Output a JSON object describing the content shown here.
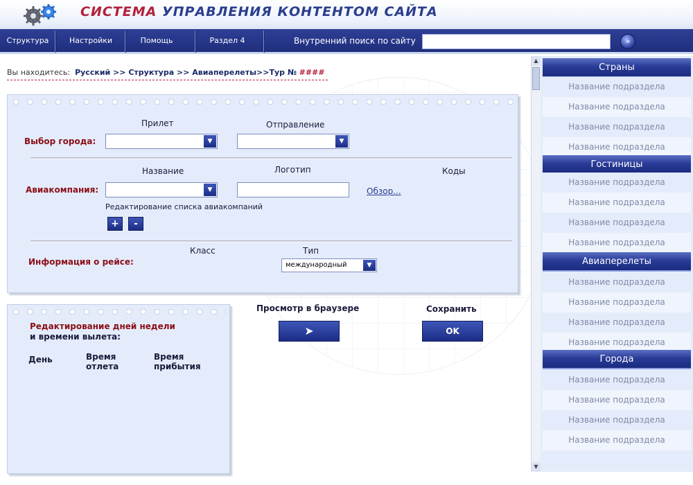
{
  "app": {
    "title_red": "СИСТЕМА",
    "title_rest": "УПРАВЛЕНИЯ КОНТЕНТОМ САЙТА",
    "logo_icon": "gears-icon"
  },
  "nav": {
    "items": [
      "Структура",
      "Настройки",
      "Помощь",
      "Раздел 4"
    ]
  },
  "search": {
    "label": "Внутренний поиск по сайту",
    "value": "",
    "placeholder": "",
    "go_icon": "arrow-right-icon"
  },
  "breadcrumb": {
    "label": "Вы находитесь:",
    "path": "Русский >> Структура >> Авиаперелеты>>Тур №",
    "hash": "####"
  },
  "form": {
    "city": {
      "label": "Выбор города:",
      "arrival": "Прилет",
      "departure": "Отправление",
      "arrival_value": "",
      "departure_value": ""
    },
    "airline": {
      "label": "Авиакомпания:",
      "name": "Название",
      "logo": "Логотип",
      "codes": "Коды",
      "name_value": "",
      "logo_value": "",
      "browse": "Обзор...",
      "edit_list": "Редактирование списка авиакомпаний",
      "add": "+",
      "remove": "-"
    },
    "flight": {
      "label": "Информация о рейсе:",
      "class": "Класс",
      "type": "Тип",
      "type_value": "международный"
    }
  },
  "schedule": {
    "title_line1": "Редактирование дней недели",
    "title_line2": "и времени вылета:",
    "col_day": "День",
    "col_depart_1": "Время",
    "col_depart_2": "отлета",
    "col_arrive_1": "Время",
    "col_arrive_2": "прибытия"
  },
  "actions": {
    "preview_label": "Просмотр в браузере",
    "preview_icon": "play-arrow-icon",
    "save_label": "Сохранить",
    "ok": "OK"
  },
  "sidebar": {
    "sections": [
      {
        "title": "Страны",
        "items": [
          "Название подраздела",
          "Название подраздела",
          "Название подраздела",
          "Название подраздела"
        ]
      },
      {
        "title": "Гостиницы",
        "items": [
          "Название подраздела",
          "Название подраздела",
          "Название подраздела",
          "Название подраздела"
        ]
      },
      {
        "title": "Авиаперелеты",
        "items": [
          "Название подраздела",
          "Название подраздела",
          "Название подраздела",
          "Название подраздела"
        ]
      },
      {
        "title": "Города",
        "items": [
          "Название подраздела",
          "Название подраздела",
          "Название подраздела",
          "Название подраздела"
        ]
      }
    ]
  },
  "colors": {
    "brand_blue": "#1f2e7d",
    "accent_red": "#b3203a",
    "panel_bg": "#e4ecfb"
  }
}
